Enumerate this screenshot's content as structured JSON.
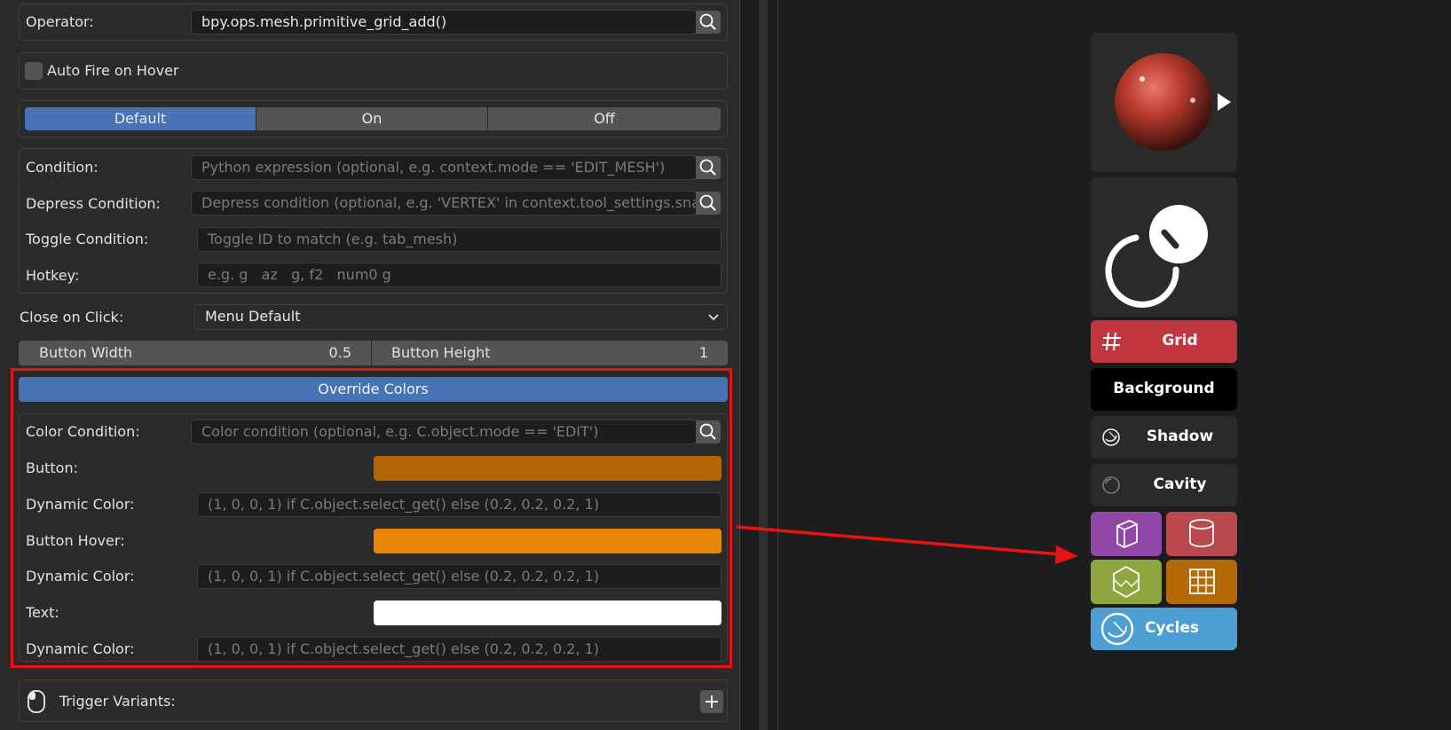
{
  "operator": {
    "label": "Operator:",
    "value": "bpy.ops.mesh.primitive_grid_add()"
  },
  "auto_fire": {
    "label": "Auto Fire on Hover"
  },
  "mode": {
    "options": [
      "Default",
      "On",
      "Off"
    ],
    "selected": "Default"
  },
  "conditions": {
    "condition": {
      "label": "Condition:",
      "placeholder": "Python expression (optional, e.g. context.mode == 'EDIT_MESH')"
    },
    "depress": {
      "label": "Depress Condition:",
      "placeholder": "Depress condition (optional, e.g. 'VERTEX' in context.tool_settings.snap_"
    },
    "toggle": {
      "label": "Toggle Condition:",
      "placeholder": "Toggle ID to match (e.g. tab_mesh)"
    },
    "hotkey": {
      "label": "Hotkey:",
      "placeholder": "e.g. g   az   g, f2   num0 g"
    }
  },
  "close_on_click": {
    "label": "Close on Click:",
    "value": "Menu Default"
  },
  "sizes": {
    "width_label": "Button Width",
    "width_value": "0.5",
    "height_label": "Button Height",
    "height_value": "1"
  },
  "override": {
    "title": "Override Colors",
    "color_condition": {
      "label": "Color Condition:",
      "placeholder": "Color condition (optional, e.g. C.object.mode == 'EDIT')"
    },
    "button": {
      "label": "Button:",
      "color": "#b56404"
    },
    "dyn1": {
      "label": "Dynamic Color:",
      "placeholder": "(1, 0, 0, 1) if C.object.select_get() else (0.2, 0.2, 0.2, 1)"
    },
    "hover": {
      "label": "Button Hover:",
      "color": "#e88606"
    },
    "dyn2": {
      "label": "Dynamic Color:",
      "placeholder": "(1, 0, 0, 1) if C.object.select_get() else (0.2, 0.2, 0.2, 1)"
    },
    "text": {
      "label": "Text:",
      "color": "#ffffff"
    },
    "dyn3": {
      "label": "Dynamic Color:",
      "placeholder": "(1, 0, 0, 1) if C.object.select_get() else (0.2, 0.2, 0.2, 1)"
    }
  },
  "trigger": {
    "label": "Trigger Variants:"
  },
  "preview": {
    "grid": "Grid",
    "background": "Background",
    "shadow": "Shadow",
    "cavity": "Cavity",
    "cycles": "Cycles",
    "colors": {
      "grid": "#c2373d",
      "purple": "#9047a8",
      "rose": "#b9494f",
      "olive": "#8fa53f",
      "orange": "#b46a06",
      "cycles": "#4d9ed2",
      "highlight": "#ee1111"
    }
  }
}
